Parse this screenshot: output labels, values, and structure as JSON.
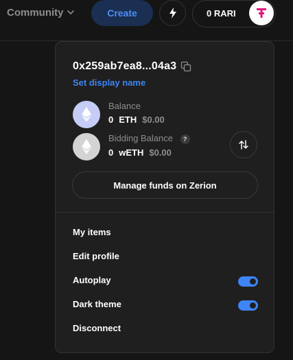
{
  "header": {
    "community_label": "Community",
    "create_label": "Create",
    "rari_balance": "0 RARI"
  },
  "account": {
    "address": "0x259ab7ea8...04a3",
    "set_display_name": "Set display name"
  },
  "balances": {
    "balance_label": "Balance",
    "balance_amount": "0",
    "balance_currency": "ETH",
    "balance_usd": "$0.00",
    "bidding_label": "Bidding Balance",
    "bidding_help": "?",
    "bidding_amount": "0",
    "bidding_currency": "wETH",
    "bidding_usd": "$0.00"
  },
  "zerion_label": "Manage funds on Zerion",
  "menu": {
    "my_items": "My items",
    "edit_profile": "Edit profile",
    "autoplay": "Autoplay",
    "autoplay_on": true,
    "dark_theme": "Dark theme",
    "dark_theme_on": true,
    "disconnect": "Disconnect"
  },
  "colors": {
    "accent": "#3d84f5",
    "background": "#151515",
    "panel": "#1f1f1f",
    "rari_pink": "#e0167c",
    "muted_text": "#8e8e8e"
  },
  "icons": [
    "chevron-down-icon",
    "bolt-icon",
    "rari-logo-icon",
    "copy-icon",
    "eth-icon",
    "weth-icon",
    "help-icon",
    "swap-icon"
  ]
}
